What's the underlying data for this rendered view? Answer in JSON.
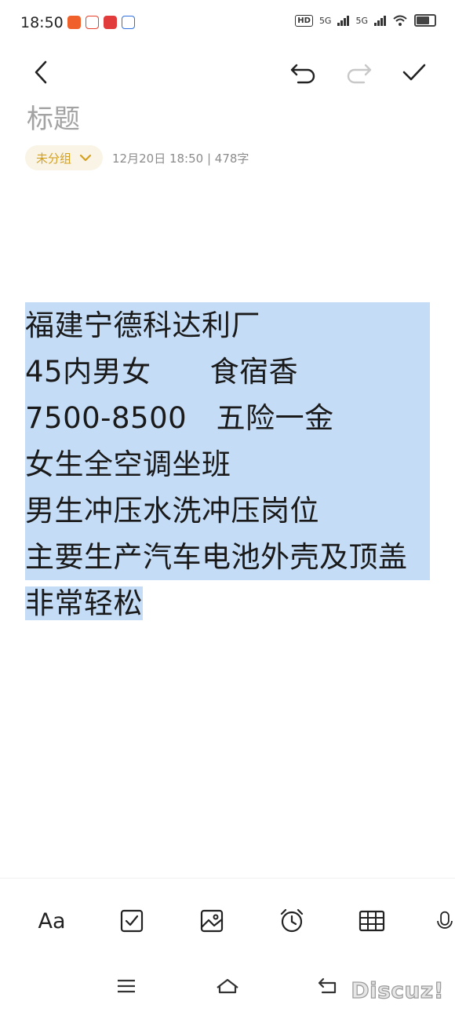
{
  "status_bar": {
    "time": "18:50",
    "notifications": [
      {
        "icon": "app-notification-icon",
        "color": "#f0602a"
      },
      {
        "icon": "app-notification-icon",
        "color": "#e8402c"
      },
      {
        "icon": "app-notification-icon",
        "color": "#e23b3b"
      },
      {
        "icon": "app-notification-icon",
        "color": "#2f6fe0"
      }
    ],
    "hd_label": "HD",
    "network_1": "5G",
    "network_2": "5G"
  },
  "toolbar": {
    "back": "back-icon",
    "undo": "undo-icon",
    "redo": "redo-icon",
    "done": "check-icon"
  },
  "note": {
    "title_placeholder": "标题",
    "group": "未分组",
    "meta": "12月20日 18:50  |  478字",
    "body_lines": [
      "福建宁德科达利厂",
      "45内男女　　食宿香",
      "7500-8500　五险一金",
      "女生全空调坐班",
      "男生冲压水洗冲压岗位",
      "主要生产汽车电池外壳及顶盖",
      "非常轻松"
    ]
  },
  "format_bar": {
    "text_style": "Aa",
    "items": [
      "text-style-icon",
      "checkbox-icon",
      "image-icon",
      "alarm-icon",
      "table-icon",
      "microphone-icon"
    ]
  },
  "nav_bar": {
    "items": [
      "menu-icon",
      "home-icon",
      "back-nav-icon"
    ]
  },
  "watermark": "Discuz!",
  "colors": {
    "accent": "#d4a020",
    "selection": "#c4dcf6",
    "chip_bg": "#faf4e6",
    "title_placeholder": "#a3a3a3"
  }
}
